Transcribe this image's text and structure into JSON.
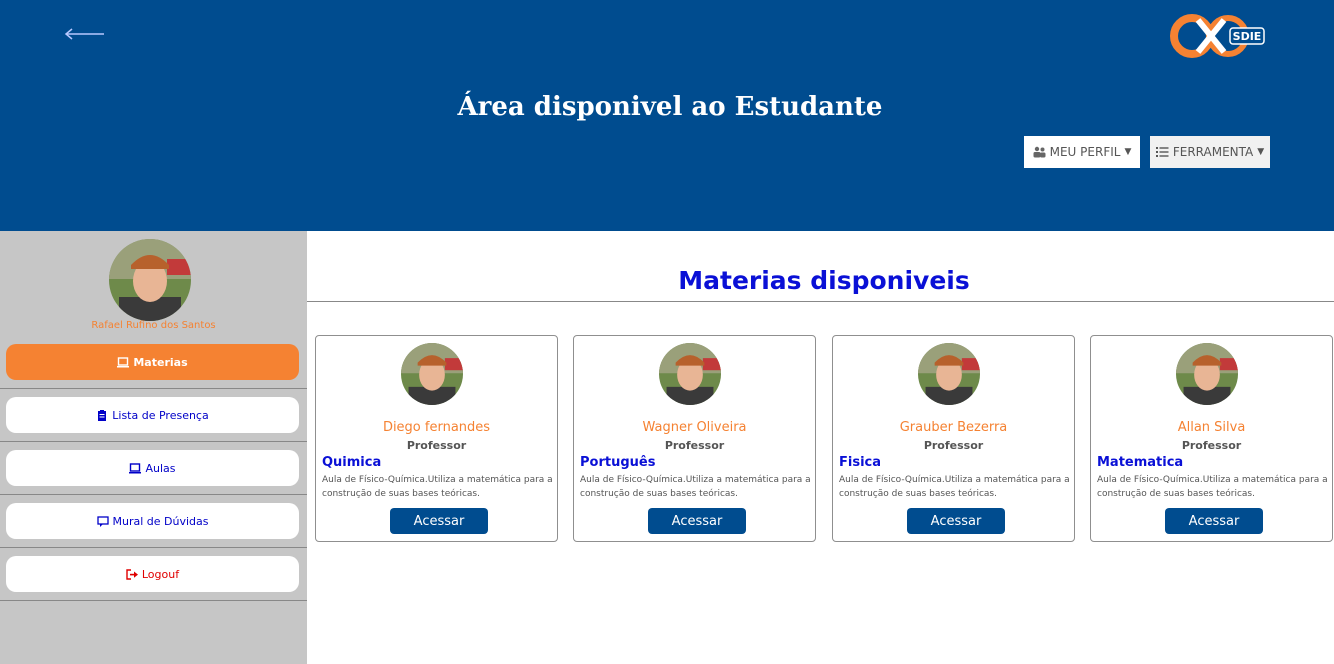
{
  "header": {
    "title": "Área disponivel ao Estudante",
    "perfil_label": "MEU PERFIL",
    "ferramenta_label": "FERRAMENTA",
    "logo_text": "SDIE"
  },
  "sidebar": {
    "student_name": "Rafael Rufino dos Santos",
    "items": [
      {
        "label": "Materias",
        "icon": "laptop-icon"
      },
      {
        "label": "Lista de Presença",
        "icon": "clipboard-icon"
      },
      {
        "label": "Aulas",
        "icon": "laptop-icon"
      },
      {
        "label": "Mural de Dúvidas",
        "icon": "comment-icon"
      },
      {
        "label": "Logouf",
        "icon": "sign-out-icon"
      }
    ]
  },
  "main": {
    "title": "Materias disponiveis",
    "cards": [
      {
        "teacher": "Diego fernandes",
        "role": "Professor",
        "subject": "Quimica",
        "desc": "Aula de Físico-Química.Utiliza a matemática para a construção de suas bases teóricas.",
        "button": "Acessar"
      },
      {
        "teacher": "Wagner Oliveira",
        "role": "Professor",
        "subject": "Português",
        "desc": "Aula de Físico-Química.Utiliza a matemática para a construção de suas bases teóricas.",
        "button": "Acessar"
      },
      {
        "teacher": "Grauber Bezerra",
        "role": "Professor",
        "subject": "Fisica",
        "desc": "Aula de Físico-Química.Utiliza a matemática para a construção de suas bases teóricas.",
        "button": "Acessar"
      },
      {
        "teacher": "Allan Silva",
        "role": "Professor",
        "subject": "Matematica",
        "desc": "Aula de Físico-Química.Utiliza a matemática para a construção de suas bases teóricas.",
        "button": "Acessar"
      }
    ]
  },
  "colors": {
    "header_bg": "#004c8f",
    "accent_orange": "#f58232",
    "title_blue": "#0a10d6",
    "sidebar_bg": "#c6c6c6"
  }
}
